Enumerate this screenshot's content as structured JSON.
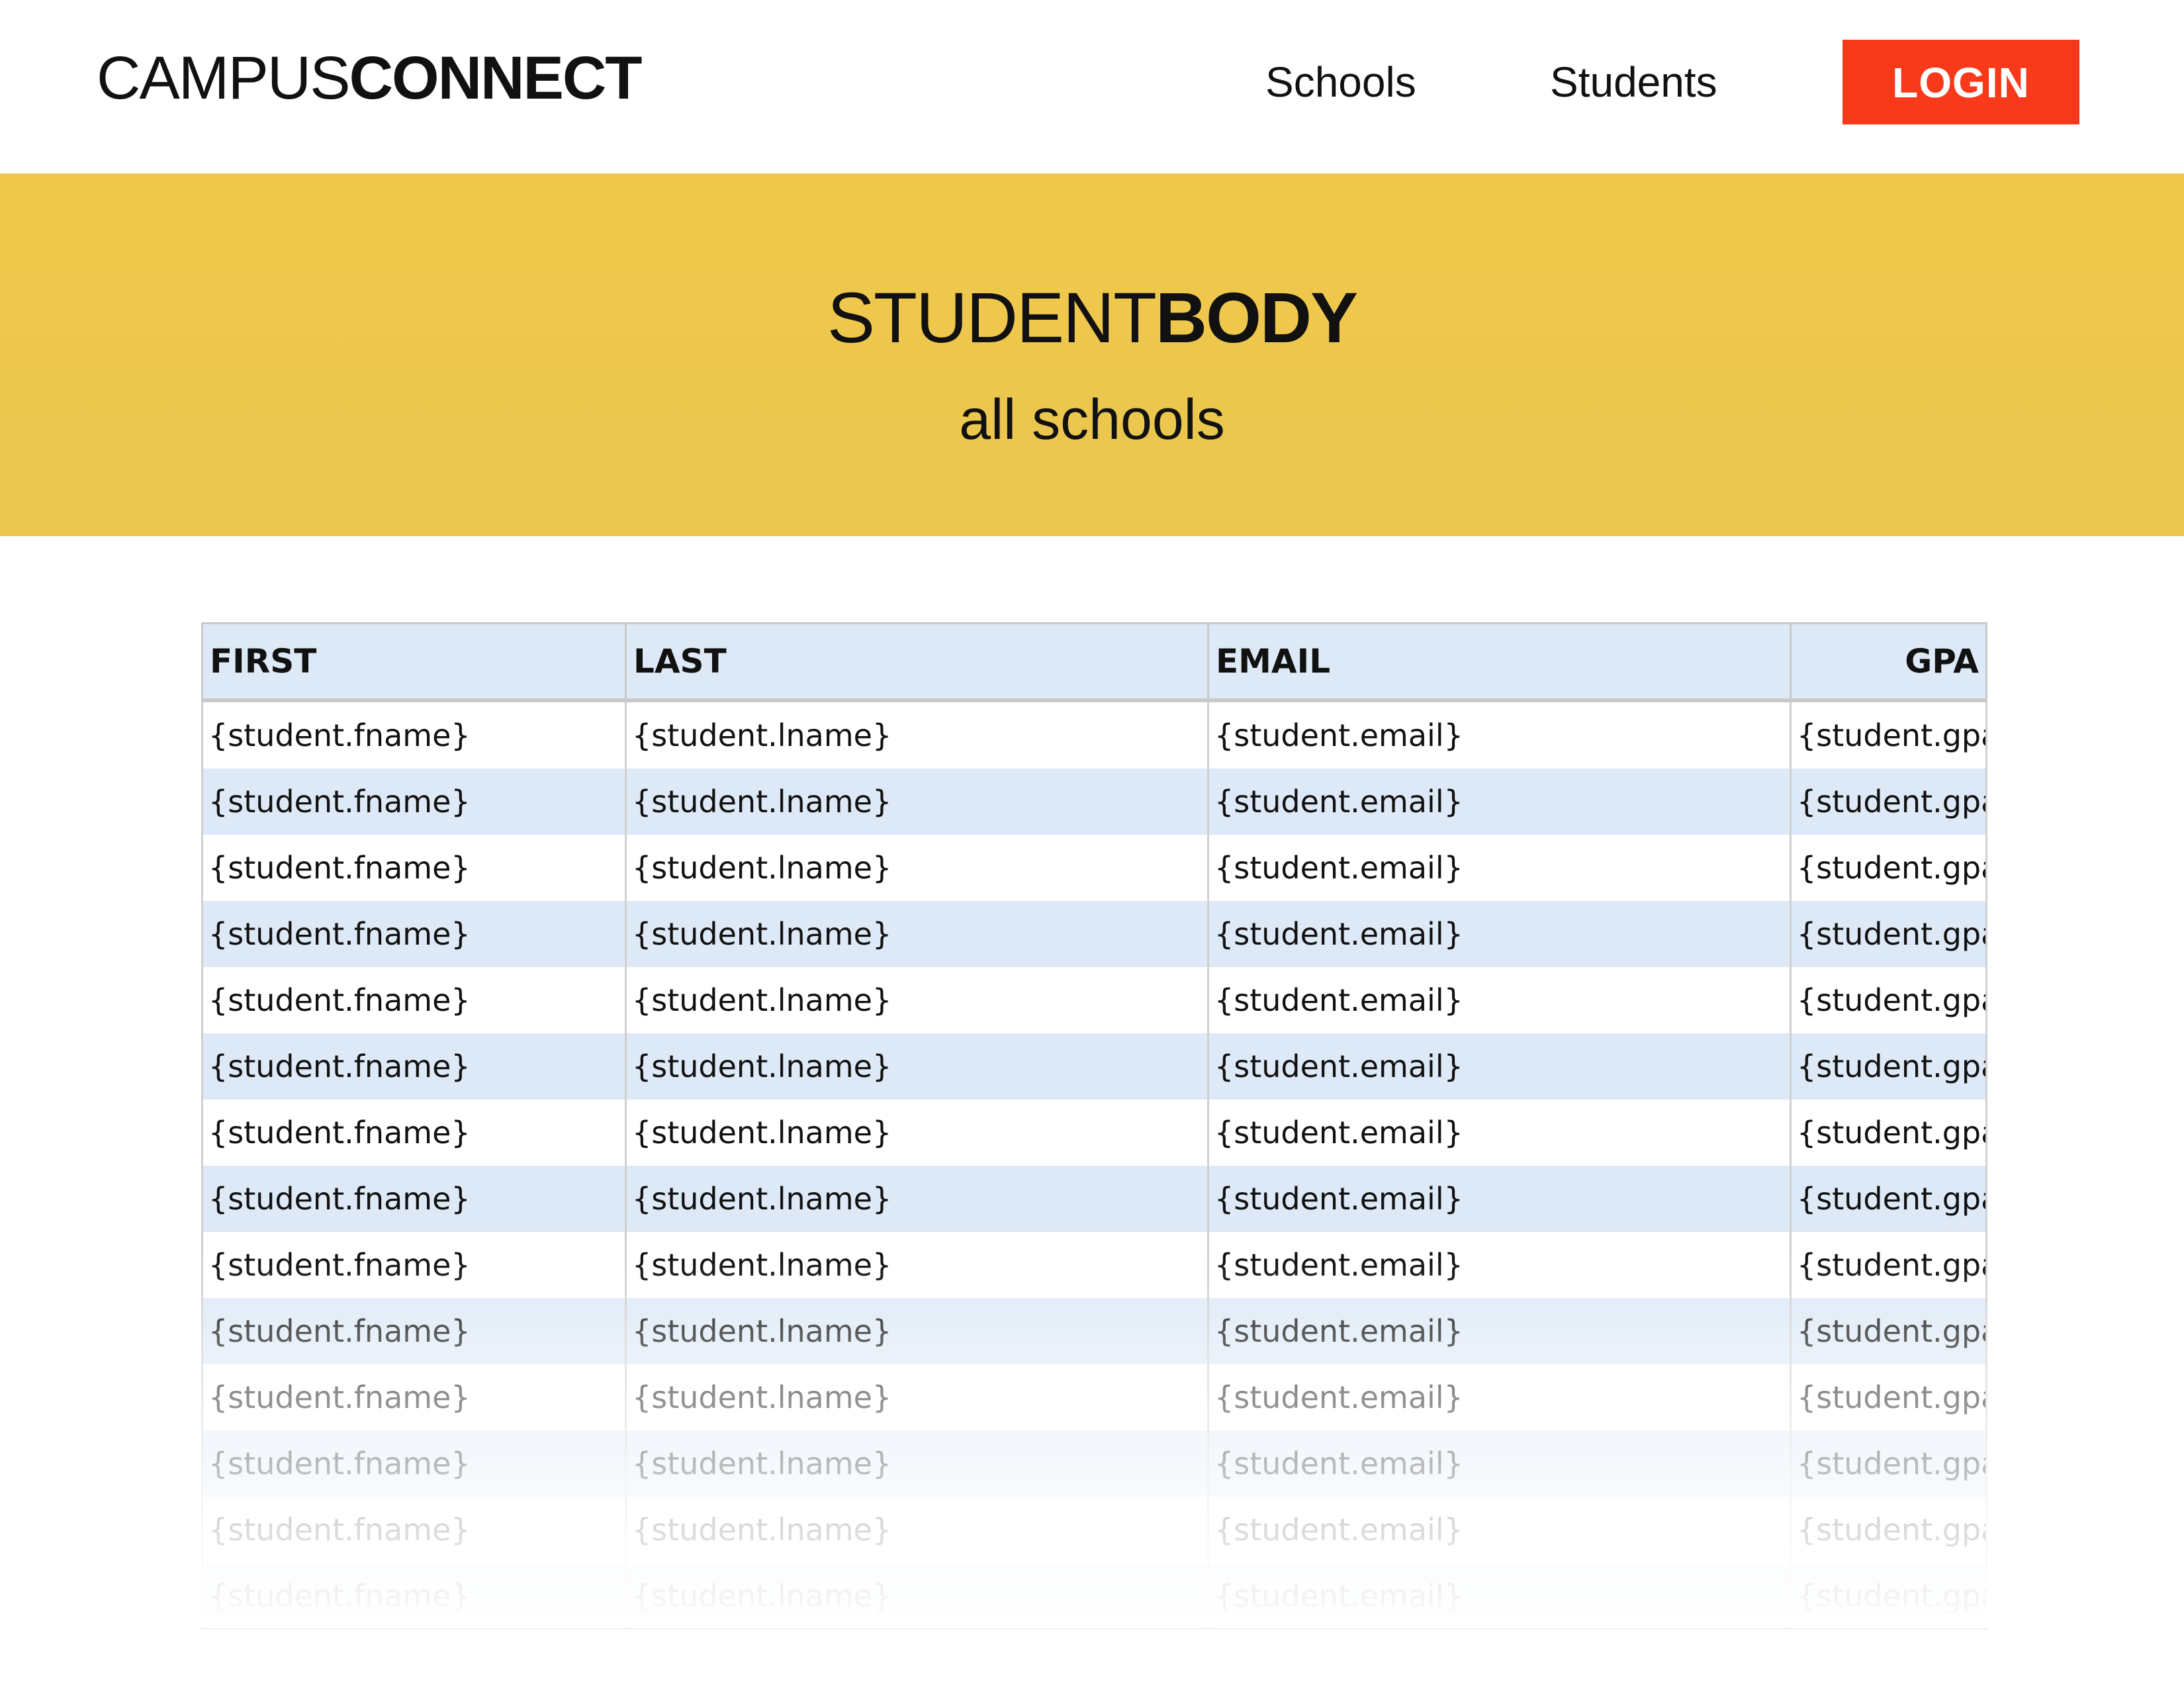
{
  "header": {
    "logo_light": "CAMPUS",
    "logo_bold": "CONNECT",
    "nav": [
      {
        "label": "Schools"
      },
      {
        "label": "Students"
      }
    ],
    "login_label": "LOGIN"
  },
  "banner": {
    "title_light": "STUDENT",
    "title_bold": "BODY",
    "subtitle": "all schools"
  },
  "table": {
    "columns": [
      "FIRST",
      "LAST",
      "EMAIL",
      "GPA"
    ],
    "rows": [
      [
        "{student.fname}",
        "{student.lname}",
        "{student.email}",
        "{student.gpa}"
      ],
      [
        "{student.fname}",
        "{student.lname}",
        "{student.email}",
        "{student.gpa}"
      ],
      [
        "{student.fname}",
        "{student.lname}",
        "{student.email}",
        "{student.gpa}"
      ],
      [
        "{student.fname}",
        "{student.lname}",
        "{student.email}",
        "{student.gpa}"
      ],
      [
        "{student.fname}",
        "{student.lname}",
        "{student.email}",
        "{student.gpa}"
      ],
      [
        "{student.fname}",
        "{student.lname}",
        "{student.email}",
        "{student.gpa}"
      ],
      [
        "{student.fname}",
        "{student.lname}",
        "{student.email}",
        "{student.gpa}"
      ],
      [
        "{student.fname}",
        "{student.lname}",
        "{student.email}",
        "{student.gpa}"
      ],
      [
        "{student.fname}",
        "{student.lname}",
        "{student.email}",
        "{student.gpa}"
      ],
      [
        "{student.fname}",
        "{student.lname}",
        "{student.email}",
        "{student.gpa}"
      ],
      [
        "{student.fname}",
        "{student.lname}",
        "{student.email}",
        "{student.gpa}"
      ],
      [
        "{student.fname}",
        "{student.lname}",
        "{student.email}",
        "{student.gpa}"
      ],
      [
        "{student.fname}",
        "{student.lname}",
        "{student.email}",
        "{student.gpa}"
      ],
      [
        "{student.fname}",
        "{student.lname}",
        "{student.email}",
        "{student.gpa}"
      ]
    ]
  },
  "colors": {
    "accent": "#f83a1b",
    "banner": "#f1c84a",
    "row_alt": "#dde9f6"
  }
}
